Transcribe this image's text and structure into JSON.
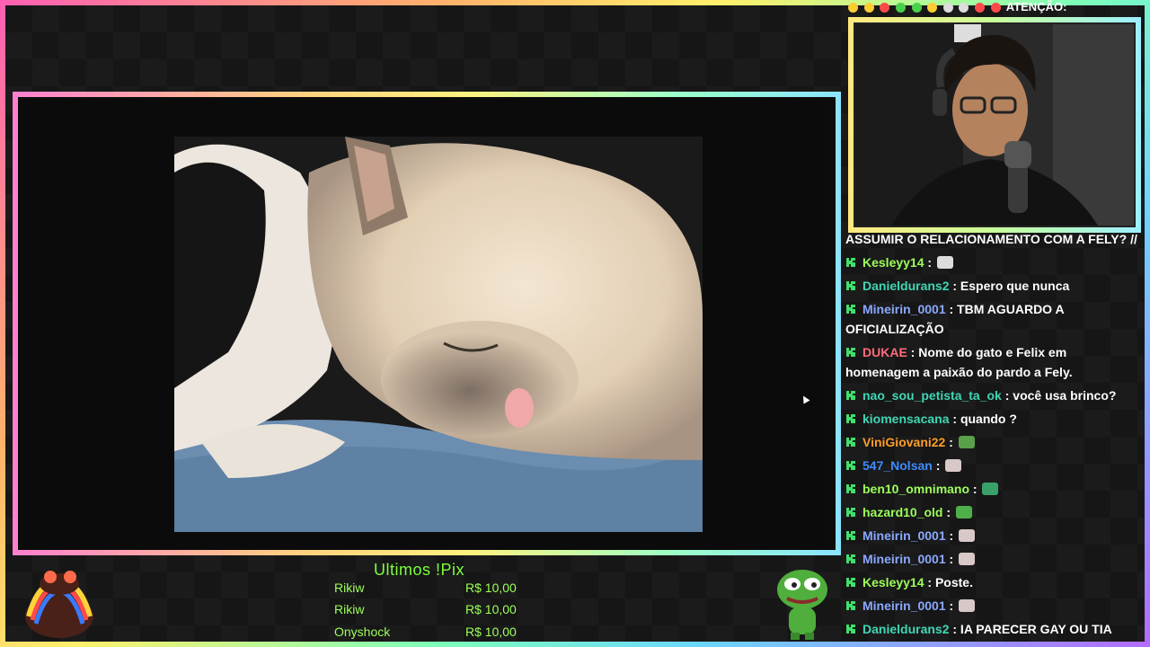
{
  "top_strip": {
    "text": "ATENÇÃO:"
  },
  "chat": {
    "first_line": "ASSUMIR O RELACIONAMENTO COM A FELY? //",
    "messages": [
      {
        "user": "Kesleyy14",
        "color": "#9dff5a",
        "text": " : ",
        "emote": "mute-emote",
        "emote_color": "#dddddd"
      },
      {
        "user": "Danieldurans2",
        "color": "#3fd7b4",
        "text": " : Espero que nunca"
      },
      {
        "user": "Mineirin_0001",
        "color": "#8aa9ff",
        "text": " : TBM AGUARDO A OFICIALIZAÇÃO"
      },
      {
        "user": "DUKAE",
        "color": "#ff6b7a",
        "text": " : Nome do gato e Felix em homenagem a paixão do pardo a Fely."
      },
      {
        "user": "nao_sou_petista_ta_ok",
        "color": "#3fd7b4",
        "text": " : você usa brinco?"
      },
      {
        "user": "kiomensacana",
        "color": "#3fd7b4",
        "text": " : quando ?"
      },
      {
        "user": "ViniGiovani22",
        "color": "#ff9d2a",
        "text": " : ",
        "emote": "frog-emote",
        "emote_color": "#5aa04a"
      },
      {
        "user": "547_Nolsan",
        "color": "#3f8cff",
        "text": " : ",
        "emote": "cat-emote",
        "emote_color": "#d8c8c8"
      },
      {
        "user": "ben10_omnimano",
        "color": "#9dff5a",
        "text": " : ",
        "emote": "blob-emote",
        "emote_color": "#3aa06a"
      },
      {
        "user": "hazard10_old",
        "color": "#9dff5a",
        "text": " : ",
        "emote": "pepe-emote",
        "emote_color": "#4fb04a"
      },
      {
        "user": "Mineirin_0001",
        "color": "#8aa9ff",
        "text": " : ",
        "emote": "cat-emote",
        "emote_color": "#d8c8c8"
      },
      {
        "user": "Mineirin_0001",
        "color": "#8aa9ff",
        "text": " : ",
        "emote": "cat-emote",
        "emote_color": "#d8c8c8"
      },
      {
        "user": "Kesleyy14",
        "color": "#9dff5a",
        "text": " : Poste."
      },
      {
        "user": "Mineirin_0001",
        "color": "#8aa9ff",
        "text": " : ",
        "emote": "cat-emote",
        "emote_color": "#d8c8c8"
      },
      {
        "user": "Danieldurans2",
        "color": "#3fd7b4",
        "text": " : IA PARECER GAY OU TIA"
      }
    ]
  },
  "pix": {
    "title": "Ultimos !Pix",
    "rows": [
      {
        "name": "Rikiw",
        "amount": "R$ 10,00"
      },
      {
        "name": "Rikiw",
        "amount": "R$ 10,00"
      },
      {
        "name": "Onyshock",
        "amount": "R$ 10,00"
      }
    ]
  },
  "colors": {
    "accent": "#7dff3a",
    "chat_icon": "#3fe06b"
  }
}
